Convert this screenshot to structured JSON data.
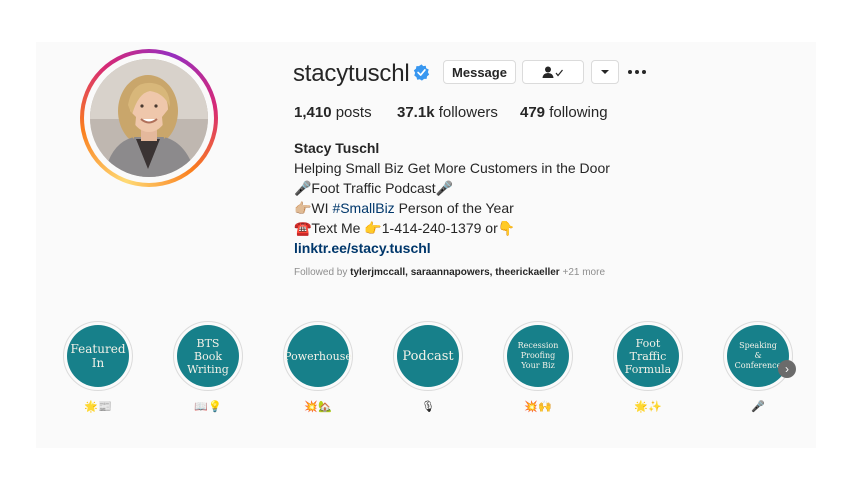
{
  "profile": {
    "username": "stacytuschl",
    "verified": true,
    "buttons": {
      "message": "Message",
      "follow_icon": "person-check-icon",
      "dropdown_icon": "caret-down-icon",
      "more_icon": "ellipsis-icon"
    },
    "stats": {
      "posts_count": "1,410",
      "posts_label": "posts",
      "followers_count": "37.1k",
      "followers_label": "followers",
      "following_count": "479",
      "following_label": "following"
    },
    "bio": {
      "name": "Stacy Tuschl",
      "line1": "Helping Small Biz Get More Customers in the Door",
      "line2": "🎤Foot Traffic Podcast🎤",
      "line3_pre": "👉🏼WI ",
      "line3_tag": "#SmallBiz",
      "line3_post": " Person of the Year",
      "line4": "☎️Text Me 👉1-414-240-1379 or👇",
      "link": "linktr.ee/stacy.tuschl"
    },
    "followed_by": {
      "prefix": "Followed by",
      "users": "tylerjmccall, saraannapowers, theerickaeller",
      "more": "+21 more"
    }
  },
  "highlights": [
    {
      "title": "Featured In",
      "lines": [
        "Featured",
        "In"
      ],
      "emoji": "🌟📰"
    },
    {
      "title": "BTS Book Writing",
      "lines": [
        "BTS",
        "Book",
        "Writing"
      ],
      "emoji": "📖💡"
    },
    {
      "title": "Powerhouse",
      "lines": [
        "Powerhouse"
      ],
      "emoji": "💥🏡"
    },
    {
      "title": "Podcast",
      "lines": [
        "Podcast"
      ],
      "emoji": "🎙"
    },
    {
      "title": "Recession Proofing Your Biz",
      "lines": [
        "Recession",
        "Proofing",
        "Your Biz"
      ],
      "emoji": "💥🙌"
    },
    {
      "title": "Foot Traffic Formula",
      "lines": [
        "Foot",
        "Traffic",
        "Formula"
      ],
      "emoji": "🌟✨"
    },
    {
      "title": "Speaking & Conference",
      "lines": [
        "Speaking",
        "&",
        "Conference"
      ],
      "emoji": "🎤"
    }
  ],
  "colors": {
    "highlight_bg": "#17808a",
    "verified": "#3897f0",
    "link": "#00376b"
  }
}
